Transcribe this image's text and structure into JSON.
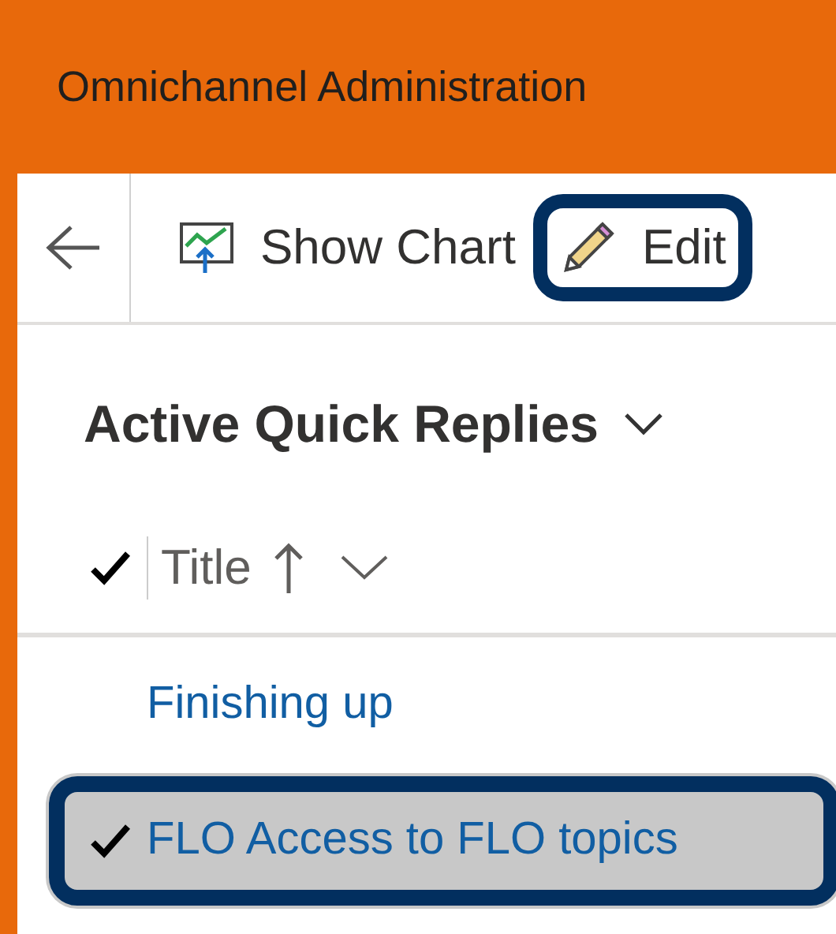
{
  "app_title": "Omnichannel Administration",
  "toolbar": {
    "buttons": [
      {
        "kind": "chart",
        "label": "Show Chart",
        "highlighted": false
      },
      {
        "kind": "edit",
        "label": "Edit",
        "highlighted": true
      }
    ]
  },
  "view_title": "Active Quick Replies",
  "grid": {
    "header_checked": true,
    "columns": [
      {
        "label": "Title",
        "sorted_ascending": true
      }
    ],
    "rows": [
      {
        "title": "Finishing up",
        "selected": false
      },
      {
        "title": "FLO Access to FLO topics",
        "selected": true
      }
    ]
  }
}
